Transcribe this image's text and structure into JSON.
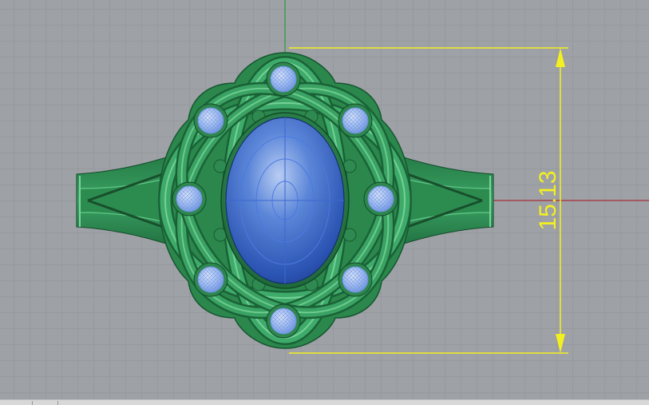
{
  "viewport": {
    "view": "Top",
    "background_color": "#9ea1a6",
    "grid_color": "#8f9297",
    "x_axis_color": "#a8303a",
    "y_axis_color": "#2b9a3a"
  },
  "model": {
    "metal_color": "#2f8f52",
    "metal_dark": "#1b6a38",
    "metal_light": "#62c487",
    "center_stone_color": "#3c6fd0",
    "accent_stone_color": "#8fb3f2",
    "accent_stone_count": 8
  },
  "dimension": {
    "label": "15.13",
    "color": "#f2f020"
  }
}
